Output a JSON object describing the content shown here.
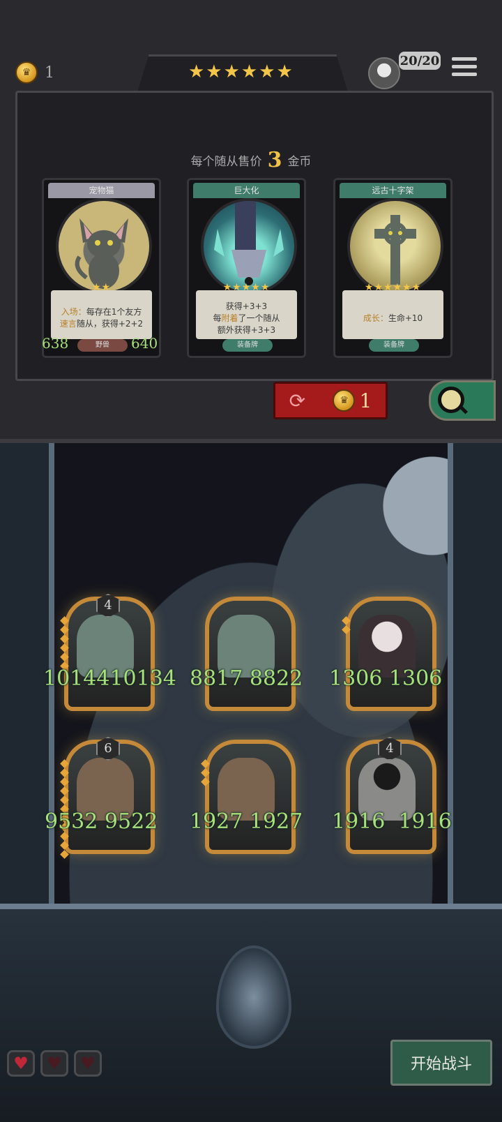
{
  "header": {
    "coins": "1",
    "shop_stars": "★★★★★★",
    "capacity": "20/20"
  },
  "shop": {
    "price_prefix": "每个随从售价",
    "price_value": "3",
    "price_suffix": "金币",
    "cards": [
      {
        "name": "宠物猫",
        "stars": "★★",
        "desc_line1_prefix": "入场：",
        "desc_line1_rest": "每存在1个友方",
        "desc_line2_keyword": "速言",
        "desc_line2_rest": "随从，获得+2+2",
        "tag": "野兽",
        "attack": "638",
        "health": "640",
        "color": "#9b98a5"
      },
      {
        "name": "巨大化",
        "stars": "★★★★★",
        "desc_line1": "获得+3+3",
        "desc_line2_prefix": "每",
        "desc_line2_keyword": "附着",
        "desc_line2_rest": "了一个随从",
        "desc_line3": "额外获得+3+3",
        "tag": "装备牌",
        "color": "#3f7c6a"
      },
      {
        "name": "远古十字架",
        "stars": "★★★★★★",
        "desc_keyword": "成长：",
        "desc_rest": "生命+10",
        "tag": "装备牌",
        "color": "#3f7c6a"
      }
    ],
    "refresh_cost": "1"
  },
  "board": {
    "minions": [
      {
        "level": "4",
        "attack": "10144",
        "health": "10134",
        "portrait": "crocodile"
      },
      {
        "level": "",
        "attack": "8817",
        "health": "8822",
        "portrait": "crocodile"
      },
      {
        "level": "",
        "attack": "1306",
        "health": "1306",
        "portrait": "masked-rabbit"
      },
      {
        "level": "6",
        "attack": "9532",
        "health": "9522",
        "portrait": "swordsman"
      },
      {
        "level": "",
        "attack": "1927",
        "health": "1927",
        "portrait": "swordsman"
      },
      {
        "level": "4",
        "attack": "1916",
        "health": "1916",
        "portrait": "shield-knight"
      }
    ]
  },
  "footer": {
    "lives": 3,
    "fight_label": "开始战斗"
  },
  "colors": {
    "gold": "#f3c64a",
    "stat_green": "#a8e07a",
    "refresh_red": "#a51b1b",
    "fight_green": "#2f5c48"
  }
}
